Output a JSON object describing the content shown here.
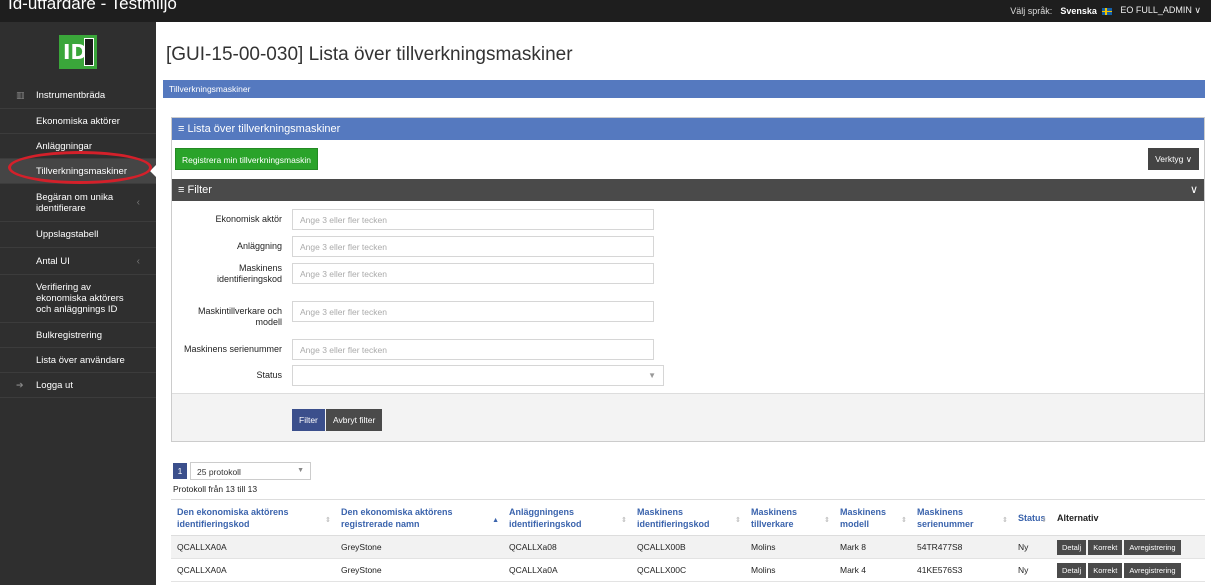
{
  "header": {
    "app_title": "Id-utfärdare - Testmiljö",
    "language_label": "Välj språk:",
    "language_value": "Svenska",
    "user": "EO FULL_ADMIN",
    "user_chevron": "∨"
  },
  "sidebar": {
    "items": [
      {
        "label": "Instrumentbräda"
      },
      {
        "label": "Ekonomiska aktörer"
      },
      {
        "label": "Anläggningar"
      },
      {
        "label": "Tillverkningsmaskiner"
      },
      {
        "label": "Begäran om unika identifierare"
      },
      {
        "label": "Uppslagstabell"
      },
      {
        "label": "Antal UI"
      },
      {
        "label": "Verifiering av ekonomiska aktörers och anläggnings ID"
      },
      {
        "label": "Bulkregistrering"
      },
      {
        "label": "Lista över användare"
      },
      {
        "label": "Logga ut"
      }
    ],
    "active": "Tillverkningsmaskiner"
  },
  "main": {
    "page_title": "[GUI-15-00-030] Lista över tillverkningsmaskiner",
    "breadcrumb": "Tillverkningsmaskiner",
    "panel_title": "≡ Lista över tillverkningsmaskiner",
    "register_button": "Registrera min tillverkningsmaskin",
    "tools_button": "Verktyg ∨",
    "filter": {
      "title": "≡ Filter",
      "fields": [
        {
          "label": "Ekonomisk aktör",
          "placeholder": "Ange 3 eller fler tecken"
        },
        {
          "label": "Anläggning",
          "placeholder": "Ange 3 eller fler tecken"
        },
        {
          "label": "Maskinens identifieringskod",
          "placeholder": "Ange 3 eller fler tecken"
        },
        {
          "label": "Maskintillverkare och modell",
          "placeholder": "Ange 3 eller fler tecken"
        },
        {
          "label": "Maskinens serienummer",
          "placeholder": "Ange 3 eller fler tecken"
        },
        {
          "label": "Status",
          "value": ""
        }
      ],
      "filter_button": "Filter",
      "cancel_button": "Avbryt filter"
    },
    "pager": {
      "page": "1",
      "page_size": "25 protokoll",
      "records_info": "Protokoll från 13 till 13"
    },
    "table": {
      "columns": [
        "Den ekonomiska aktörens identifieringskod",
        "Den ekonomiska aktörens registrerade namn",
        "Anläggningens identifieringskod",
        "Maskinens identifieringskod",
        "Maskinens tillverkare",
        "Maskinens modell",
        "Maskinens serienummer",
        "Status",
        "Alternativ"
      ],
      "rows": [
        [
          "QCALLXA0A",
          "GreyStone",
          "QCALLXa08",
          "QCALLX00B",
          "Molins",
          "Mark 8",
          "54TR477S8",
          "Ny"
        ],
        [
          "QCALLXA0A",
          "GreyStone",
          "QCALLXa0A",
          "QCALLX00C",
          "Molins",
          "Mark 4",
          "41KE576S3",
          "Ny"
        ]
      ],
      "row_actions": [
        "Detalj",
        "Korrekt",
        "Avregistrering"
      ]
    }
  }
}
